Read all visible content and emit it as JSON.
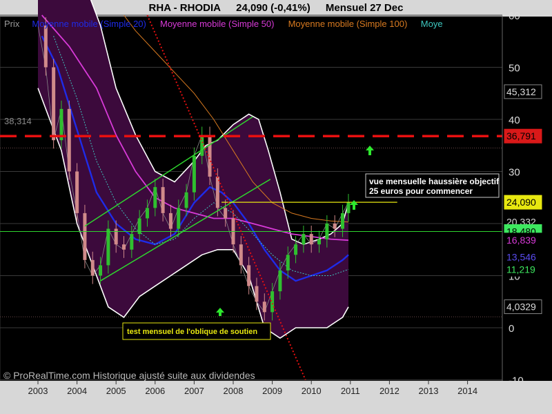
{
  "title": {
    "symbol": "RHA - RHODIA",
    "price": "24,090 (-0,41%)",
    "period": "Mensuel  27 Dec"
  },
  "legend": [
    {
      "label": "Prix",
      "color": "#9a9a9a"
    },
    {
      "label": "Moyenne mobile (Simple 20)",
      "color": "#1f2be8"
    },
    {
      "label": "Moyenne mobile (Simple 50)",
      "color": "#d83ad8"
    },
    {
      "label": "Moyenne mobile (Simple 100)",
      "color": "#d87a20"
    },
    {
      "label": "Moye",
      "color": "#3ec8c0"
    }
  ],
  "annotations": {
    "objective_line1": "vue mensuelle haussière objectif",
    "objective_line2": "25 euros pour commencer",
    "support_test": "test mensuel de l'oblique de soutien",
    "level_left": "38,314",
    "copyright": "© ProRealTime.com Historique ajusté suite aux dividendes"
  },
  "colors": {
    "background": "#000000",
    "band_fill": "#3c0a3c",
    "band_edge": "#ffffff",
    "up_candle": "#2fbf2f",
    "down_candle": "#d08a8a",
    "channel": "#2ed62e",
    "resistance": "#e81010",
    "downtrend": "#e81010",
    "objective_line": "#e8e810",
    "support_h": "#2ed62e",
    "arrow": "#2ee82e"
  },
  "chart_data": {
    "type": "candlestick",
    "x_ticks": [
      "2003",
      "2004",
      "2005",
      "2006",
      "2007",
      "2008",
      "2009",
      "2010",
      "2011",
      "2012",
      "2013",
      "2014"
    ],
    "y_ticks": [
      60,
      50,
      40,
      30,
      20,
      10,
      0,
      -10
    ],
    "ylim": [
      -10,
      60
    ],
    "xlim": [
      2002.42,
      2015.22
    ],
    "badges": [
      {
        "value": "45,312",
        "y": 45.312,
        "bg": "#000000",
        "fg": "#dddddd",
        "border": "#888888"
      },
      {
        "value": "36,791",
        "y": 36.791,
        "bg": "#d91919",
        "fg": "#000000",
        "border": "#d91919"
      },
      {
        "value": "24,090",
        "y": 24.09,
        "bg": "#e8e810",
        "fg": "#000000",
        "border": "#e8e810"
      },
      {
        "value": "20,332",
        "y": 20.332,
        "bg": "#000000",
        "fg": "#d8d8d8",
        "border": "#000000"
      },
      {
        "value": "18,480",
        "y": 18.48,
        "bg": "#3de85f",
        "fg": "#000000",
        "border": "#3de85f"
      },
      {
        "value": "16,839",
        "y": 16.839,
        "bg": "#000000",
        "fg": "#d83ad8",
        "border": "#000000"
      },
      {
        "value": "13,546",
        "y": 13.546,
        "bg": "#000000",
        "fg": "#5a4cf0",
        "border": "#000000"
      },
      {
        "value": "11,219",
        "y": 11.219,
        "bg": "#000000",
        "fg": "#3de85f",
        "border": "#000000"
      },
      {
        "value": "4,0329",
        "y": 4.0329,
        "bg": "#000000",
        "fg": "#dddddd",
        "border": "#888888"
      }
    ],
    "series": [
      {
        "name": "Moyenne mobile (Simple 20)",
        "x": [
          2003.1,
          2003.5,
          2004.0,
          2004.5,
          2005.0,
          2005.5,
          2006.0,
          2006.5,
          2007.0,
          2007.4,
          2007.7,
          2008.0,
          2008.4,
          2008.8,
          2009.2,
          2009.6,
          2010.0,
          2010.4,
          2010.8,
          2010.95
        ],
        "y": [
          56,
          50,
          38,
          26,
          20,
          17,
          16,
          18,
          24,
          27,
          26,
          24,
          20,
          15,
          11,
          9,
          10,
          11,
          13,
          14
        ]
      },
      {
        "name": "Moyenne mobile (Simple 50)",
        "x": [
          2003.1,
          2003.8,
          2004.5,
          2005.0,
          2005.5,
          2006.0,
          2006.5,
          2007.0,
          2007.5,
          2008.0,
          2008.5,
          2009.0,
          2009.5,
          2010.0,
          2010.5,
          2010.95
        ],
        "y": [
          60,
          54,
          46,
          37,
          30,
          25,
          23,
          22,
          21,
          21,
          20,
          19,
          18,
          17.5,
          17,
          16.8
        ]
      },
      {
        "name": "Moyenne mobile (Simple 100)",
        "x": [
          2005.2,
          2005.5,
          2006.0,
          2006.5,
          2007.0,
          2007.5,
          2008.0,
          2008.5,
          2009.0,
          2009.5,
          2010.0,
          2010.5,
          2010.95
        ],
        "y": [
          60,
          57,
          53,
          49,
          45,
          40,
          34,
          28,
          24,
          22,
          21,
          20.5,
          20.3
        ]
      },
      {
        "name": "Moye",
        "x": [
          2003.4,
          2004.0,
          2004.5,
          2005.0,
          2005.5,
          2006.0,
          2006.5,
          2007.0,
          2007.5,
          2008.0,
          2008.5,
          2009.0,
          2009.5,
          2010.0,
          2010.5,
          2010.95
        ],
        "y": [
          56,
          44,
          32,
          24,
          19,
          16,
          17,
          21,
          24,
          22,
          18,
          14,
          11,
          10,
          10,
          11.2
        ]
      },
      {
        "name": "band_upper",
        "x": [
          2003.0,
          2003.5,
          2004.0,
          2004.3,
          2004.6,
          2005.0,
          2005.5,
          2006.0,
          2006.5,
          2007.0,
          2007.3,
          2007.6,
          2008.0,
          2008.4,
          2008.65,
          2008.9,
          2009.2,
          2009.5,
          2009.8,
          2010.2,
          2010.5,
          2010.8,
          2010.95
        ],
        "y": [
          69,
          68,
          66,
          64,
          58,
          46,
          37,
          30,
          28,
          32,
          35,
          36,
          39,
          41,
          40,
          34,
          26,
          17,
          16,
          17,
          18,
          20,
          24
        ]
      },
      {
        "name": "band_lower",
        "x": [
          2003.0,
          2003.3,
          2003.6,
          2004.0,
          2004.4,
          2004.8,
          2005.2,
          2005.6,
          2006.0,
          2006.4,
          2006.8,
          2007.2,
          2007.6,
          2008.0,
          2008.4,
          2008.8,
          2009.2,
          2009.6,
          2010.0,
          2010.4,
          2010.8,
          2010.95
        ],
        "y": [
          46,
          40,
          34,
          20,
          12,
          4,
          2,
          6,
          8,
          10,
          12,
          14,
          15,
          15,
          10,
          0,
          -2,
          0,
          0,
          0,
          2,
          4
        ]
      },
      {
        "name": "Prix",
        "x": [
          2003.0,
          2003.2,
          2003.4,
          2003.6,
          2003.8,
          2004.0,
          2004.2,
          2004.4,
          2004.6,
          2004.8,
          2005.0,
          2005.2,
          2005.4,
          2005.6,
          2005.8,
          2006.0,
          2006.2,
          2006.4,
          2006.6,
          2006.8,
          2007.0,
          2007.2,
          2007.4,
          2007.6,
          2007.8,
          2008.0,
          2008.2,
          2008.4,
          2008.6,
          2008.8,
          2009.0,
          2009.2,
          2009.4,
          2009.6,
          2009.8,
          2010.0,
          2010.2,
          2010.4,
          2010.6,
          2010.8,
          2010.95
        ],
        "y": [
          58,
          50,
          36,
          42,
          30,
          22,
          13,
          10,
          12,
          19,
          16,
          15,
          18,
          21,
          23,
          27,
          22,
          19,
          23,
          26,
          33,
          37,
          29,
          23,
          21,
          16,
          12,
          8,
          5,
          3,
          7,
          11,
          14,
          16,
          18,
          16,
          17,
          20,
          19,
          22,
          24.09
        ]
      }
    ],
    "channel_lines": [
      {
        "x": [
          2004.2,
          2008.5
        ],
        "y": [
          19.5,
          40.5
        ]
      },
      {
        "x": [
          2004.6,
          2008.95
        ],
        "y": [
          9,
          28.5
        ]
      }
    ],
    "resistance_level": 36.791,
    "objective_level": 24.09,
    "support_level": 18.48,
    "downtrend_line": {
      "x": [
        2005.8,
        2009.85
      ],
      "y": [
        60,
        -10
      ]
    }
  }
}
